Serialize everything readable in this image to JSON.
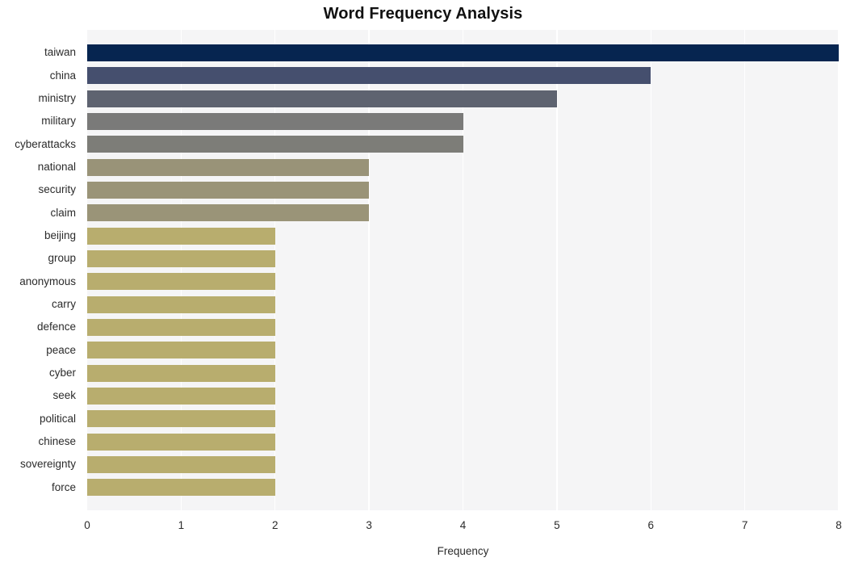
{
  "chart_data": {
    "type": "bar",
    "orientation": "horizontal",
    "title": "Word Frequency Analysis",
    "xlabel": "Frequency",
    "ylabel": "",
    "xlim": [
      0,
      8
    ],
    "xticks": [
      0,
      1,
      2,
      3,
      4,
      5,
      6,
      7,
      8
    ],
    "xtick_labels": [
      "0",
      "1",
      "2",
      "3",
      "4",
      "5",
      "6",
      "7",
      "8"
    ],
    "grid": "vertical-only",
    "legend": "none",
    "plot_background": "#f5f5f6",
    "figure_background": "#ffffff",
    "gridline_color": "#ffffff",
    "categories": [
      "taiwan",
      "china",
      "ministry",
      "military",
      "cyberattacks",
      "national",
      "security",
      "claim",
      "beijing",
      "group",
      "anonymous",
      "carry",
      "defence",
      "peace",
      "cyber",
      "seek",
      "political",
      "chinese",
      "sovereignty",
      "force"
    ],
    "values": [
      8,
      6,
      5,
      4,
      4,
      3,
      3,
      3,
      2,
      2,
      2,
      2,
      2,
      2,
      2,
      2,
      2,
      2,
      2,
      2
    ],
    "bar_colors": [
      "#062550",
      "#454f6e",
      "#5e6370",
      "#7a7a79",
      "#7d7d78",
      "#999378",
      "#9a9478",
      "#9a9478",
      "#b8ad6e",
      "#b8ad6e",
      "#b8ad6e",
      "#b8ad6e",
      "#b8ad6e",
      "#b8ad6e",
      "#b8ad6e",
      "#b8ad6e",
      "#b8ad6e",
      "#b8ad6e",
      "#b8ad6e",
      "#b8ad6e"
    ]
  }
}
